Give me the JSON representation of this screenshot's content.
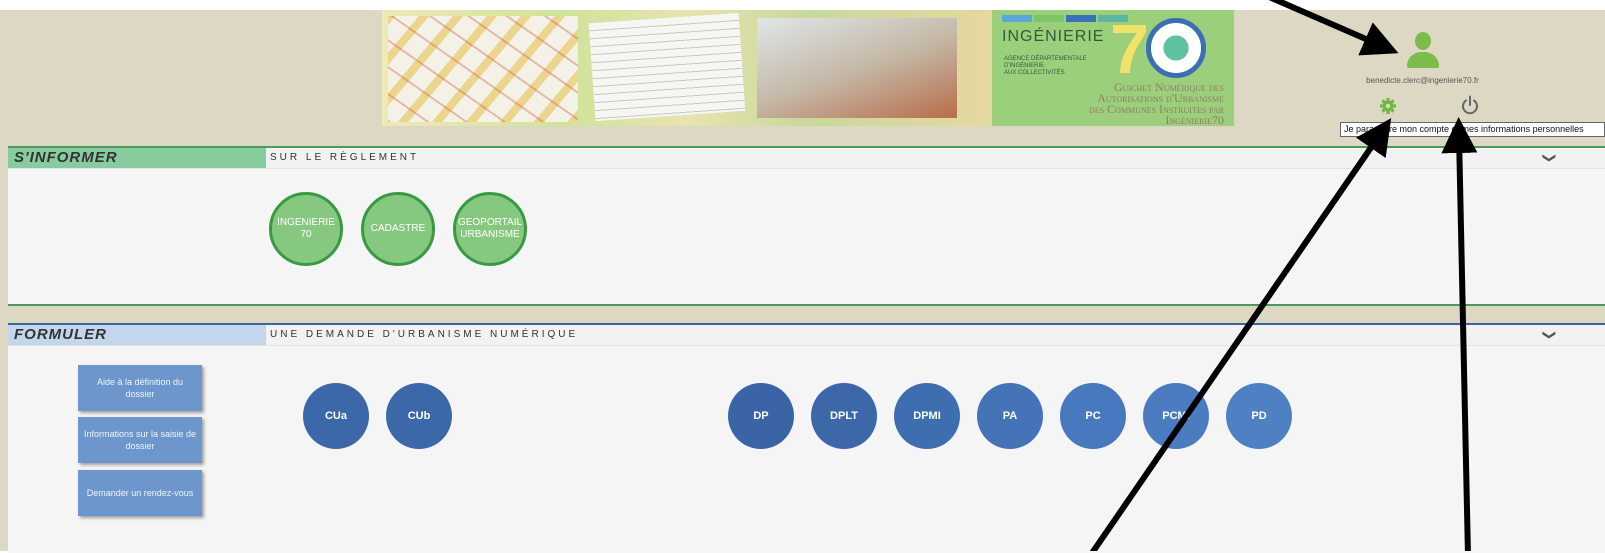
{
  "header": {
    "brand_name": "INGÉNIERIE",
    "brand_number": "7",
    "agency_text": "AGENCE DÉPARTEMENTALE\nD'INGÉNIERIE\nAUX COLLECTIVITÉS",
    "guichet_text": "Guichet Numérique des\nAutorisations d'Urbanisme\ndes Communes Instruites par\nIngénierie70",
    "brand_stripe_colors": [
      "#5aa6d8",
      "#7dc46a",
      "#3a70b6",
      "#5fb6a0"
    ],
    "user_email": "benedicte.clerc@ingenierie70.fr",
    "tooltip": "Je paramètre mon compte et mes informations personnelles",
    "icons": [
      "user-icon",
      "gear-icon",
      "power-icon"
    ]
  },
  "inform": {
    "title": "S'INFORMER",
    "subtitle": "SUR LE RÈGLEMENT",
    "chevron": "❯",
    "circles": [
      {
        "label": "INGENIERIE 70"
      },
      {
        "label": "CADASTRE"
      },
      {
        "label": "GEOPORTAIL URBANISME"
      }
    ]
  },
  "formuler": {
    "title": "FORMULER",
    "subtitle": "UNE DEMANDE D'URBANISME NUMÉRIQUE",
    "chevron": "❯",
    "side_buttons": [
      {
        "label": "Aide à la définition du dossier"
      },
      {
        "label": "Informations sur la saisie de dossier"
      },
      {
        "label": "Demander un rendez-vous"
      }
    ],
    "cu_circles": [
      {
        "label": "CUa",
        "color": "#3c67a8"
      },
      {
        "label": "CUb",
        "color": "#3c67a8"
      }
    ],
    "request_circles": [
      {
        "label": "DP",
        "color": "#3a64a6"
      },
      {
        "label": "DPLT",
        "color": "#3c68aa"
      },
      {
        "label": "DPMI",
        "color": "#3e6db0"
      },
      {
        "label": "PA",
        "color": "#4473b8"
      },
      {
        "label": "PC",
        "color": "#4878bd"
      },
      {
        "label": "PCMI",
        "color": "#4b7cc0"
      },
      {
        "label": "PD",
        "color": "#4f80c4"
      }
    ]
  },
  "colors": {
    "inform_accent": "#86cc9e",
    "formuler_accent": "#c3d6ec",
    "user_icon": "#7dbb4a"
  }
}
